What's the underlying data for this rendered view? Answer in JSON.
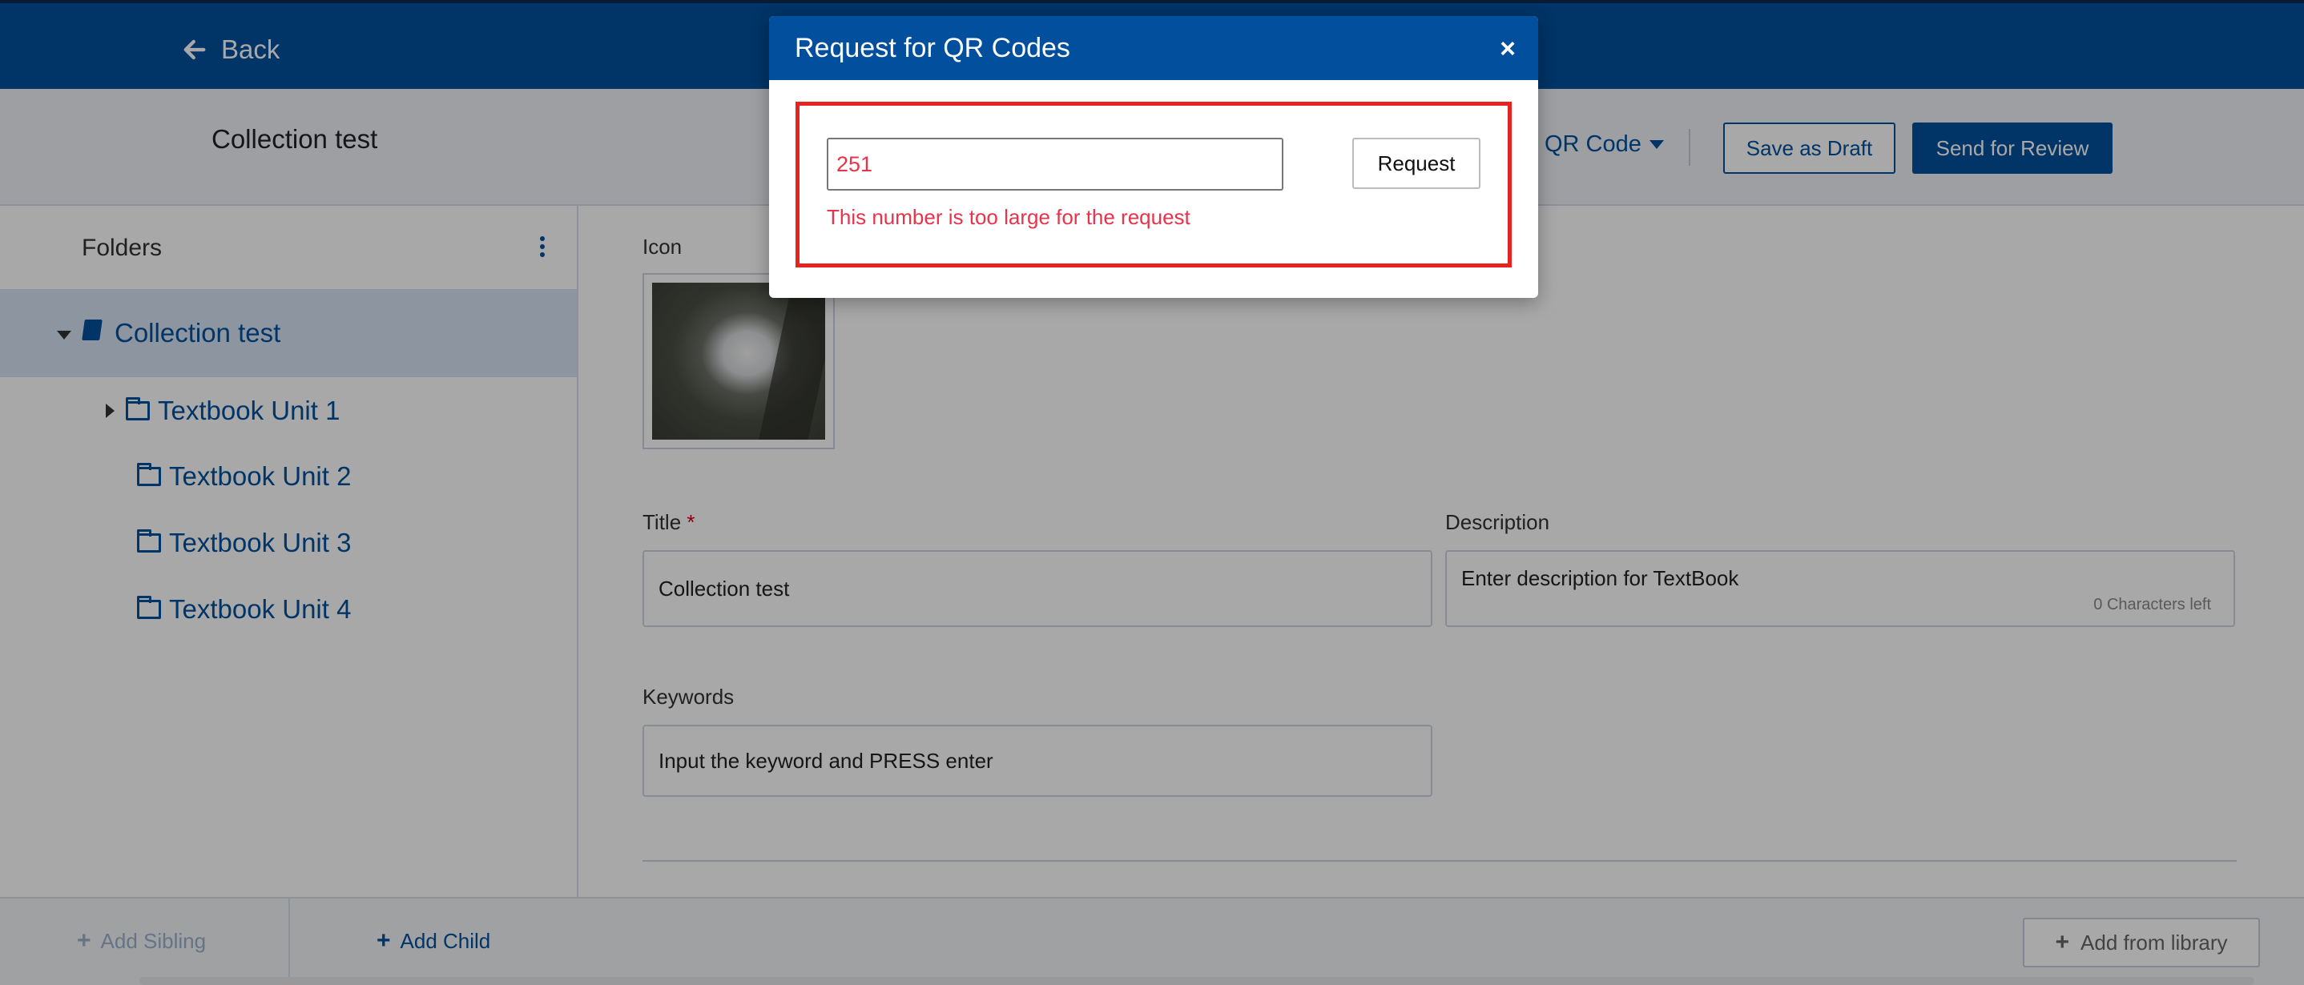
{
  "header": {
    "back_label": "Back"
  },
  "subheader": {
    "title": "Collection test",
    "qr_menu_label": "QR Code",
    "save_draft_label": "Save as Draft",
    "send_review_label": "Send for Review"
  },
  "sidebar": {
    "heading": "Folders",
    "root": {
      "label": "Collection test",
      "expanded": true
    },
    "items": [
      {
        "label": "Textbook Unit 1",
        "has_children": true
      },
      {
        "label": "Textbook Unit 2",
        "has_children": false
      },
      {
        "label": "Textbook Unit 3",
        "has_children": false
      },
      {
        "label": "Textbook Unit 4",
        "has_children": false
      }
    ],
    "add_sibling_label": "Add Sibling",
    "add_child_label": "Add Child"
  },
  "form": {
    "icon_label": "Icon",
    "title_label": "Title",
    "title_required_mark": "*",
    "title_value": "Collection test",
    "description_label": "Description",
    "description_placeholder": "Enter description for TextBook",
    "chars_left": "0 Characters left",
    "keywords_label": "Keywords",
    "keywords_placeholder": "Input the keyword and PRESS enter"
  },
  "bottombar": {
    "add_library_label": "Add from library"
  },
  "modal": {
    "title": "Request for QR Codes",
    "close_symbol": "×",
    "input_value": "251",
    "error_text": "This number is too large for the request",
    "request_label": "Request"
  },
  "colors": {
    "brand": "#024f9d",
    "error": "#e8344b",
    "highlight": "#e8221d"
  }
}
